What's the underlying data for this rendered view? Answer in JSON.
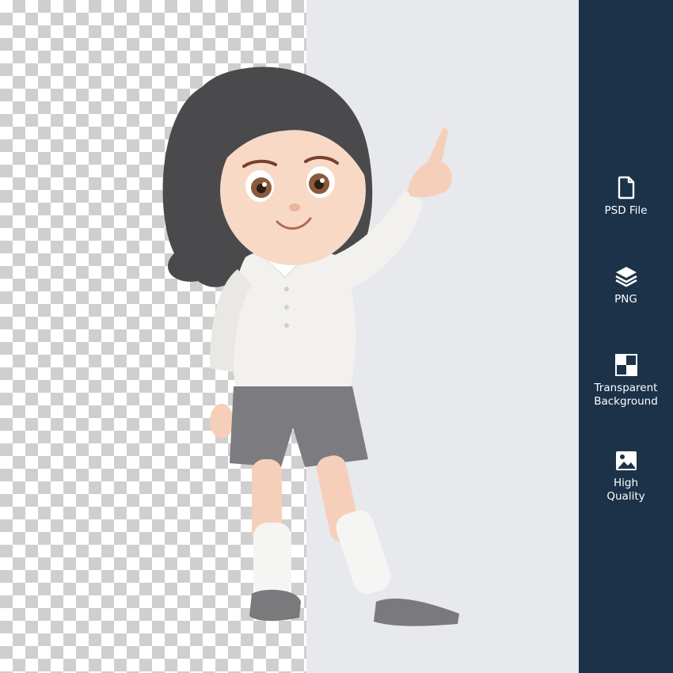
{
  "colors": {
    "sidebar": "#1b3249",
    "canvas": "#e8e9ed",
    "checker_dark": "#cfcfcf",
    "checker_light": "#ffffff"
  },
  "features": [
    {
      "icon": "file-icon",
      "label": "PSD File"
    },
    {
      "icon": "layers-icon",
      "label": "PNG"
    },
    {
      "icon": "transparency-grid-icon",
      "label": "Transparent\nBackground"
    },
    {
      "icon": "image-icon",
      "label": "High\nQuality"
    }
  ]
}
